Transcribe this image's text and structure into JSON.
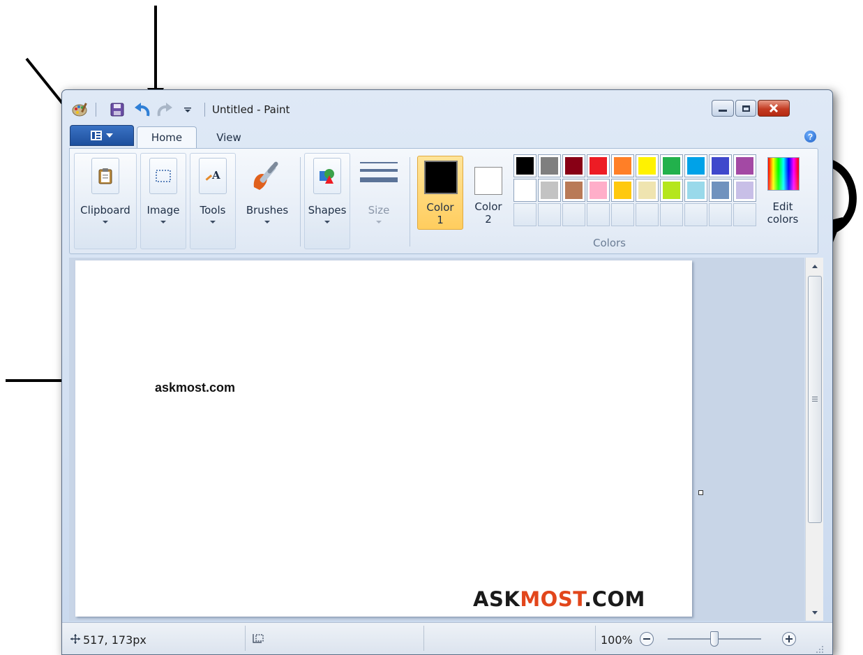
{
  "window": {
    "title": "Untitled - Paint",
    "quick_access": [
      "paint-app-icon",
      "save-icon",
      "undo-icon",
      "redo-icon",
      "customize-toolbar-icon"
    ],
    "controls": [
      "minimize-icon",
      "maximize-icon",
      "close-icon"
    ]
  },
  "ribbon": {
    "tabs": [
      {
        "label": "Home",
        "active": true
      },
      {
        "label": "View",
        "active": false
      }
    ],
    "groups": {
      "clipboard": "Clipboard",
      "image": "Image",
      "tools": "Tools",
      "brushes": "Brushes",
      "shapes": "Shapes",
      "size": "Size"
    },
    "color1_label_line1": "Color",
    "color1_label_line2": "1",
    "color2_label_line1": "Color",
    "color2_label_line2": "2",
    "color1_value": "#000000",
    "color2_value": "#ffffff",
    "palette_row1": [
      "#000000",
      "#7f7f7f",
      "#880015",
      "#ed1c24",
      "#ff7f27",
      "#fff200",
      "#22b14c",
      "#00a2e8",
      "#3f48cc",
      "#a349a4"
    ],
    "palette_row2": [
      "#ffffff",
      "#c3c3c3",
      "#b97a57",
      "#ffaec9",
      "#ffc90e",
      "#efe4b0",
      "#b5e61d",
      "#99d9ea",
      "#7092be",
      "#c8bfe7"
    ],
    "palette_row3_empty_count": 10,
    "edit_colors_line1": "Edit",
    "edit_colors_line2": "colors",
    "colors_group_caption": "Colors"
  },
  "canvas": {
    "text": "askmost.com",
    "watermark_prefix": "ASK",
    "watermark_accent": "MOST",
    "watermark_suffix": ".COM",
    "watermark_accent_color": "#e2461b"
  },
  "status": {
    "cursor_position": "517, 173px",
    "zoom": "100%",
    "zoom_slider_level": 0.5
  }
}
